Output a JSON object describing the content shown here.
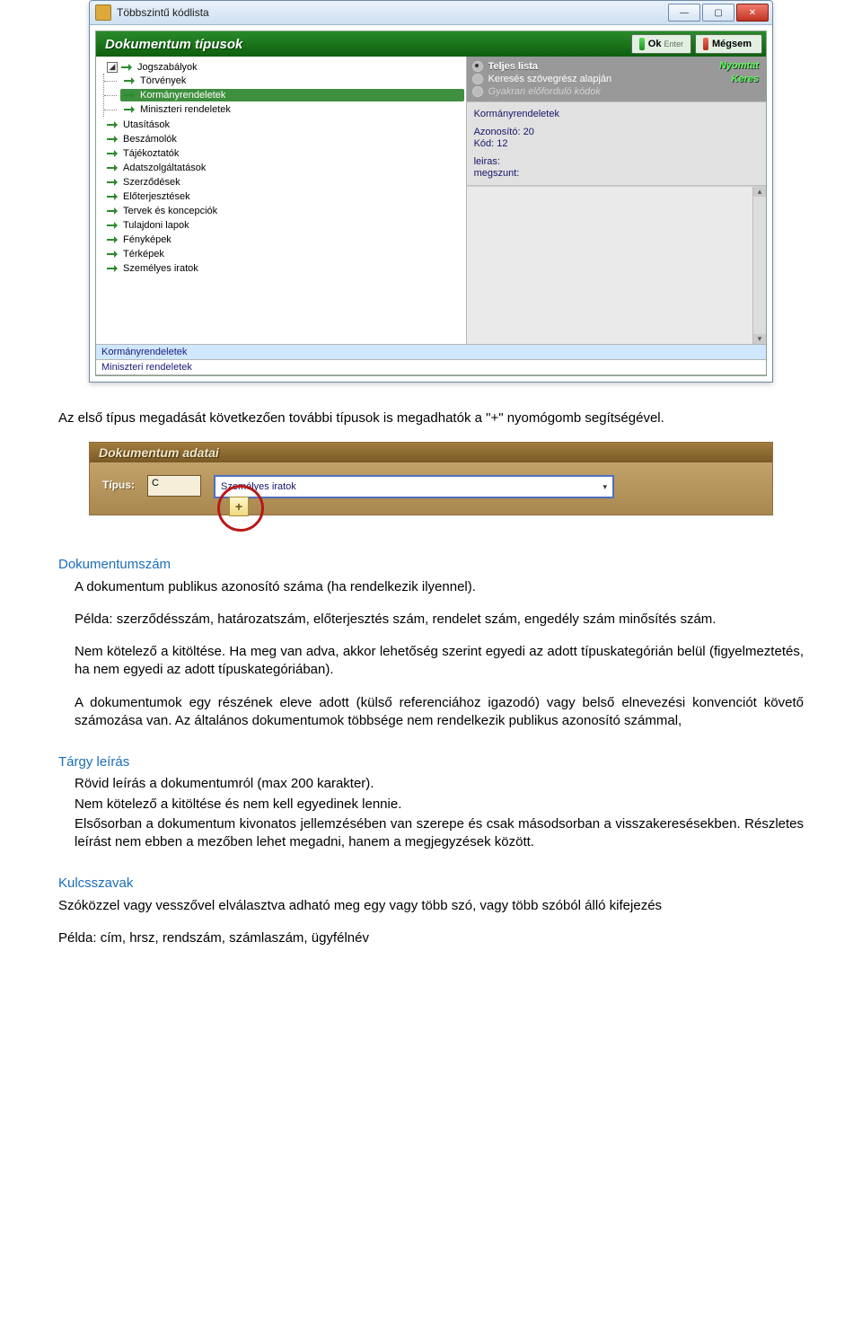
{
  "window": {
    "title": "Többszintű kódlista",
    "minimize": "—",
    "maximize": "▢",
    "close": "✕"
  },
  "ribbon": {
    "title": "Dokumentum típusok",
    "ok_bold": "Ok",
    "ok_sub": "Enter",
    "cancel_bold": "Mégsem"
  },
  "tree": {
    "root": "Jogszabályok",
    "children": [
      "Törvények",
      "Kormányrendeletek",
      "Miniszteri rendeletek"
    ],
    "selected_index": 1,
    "siblings": [
      "Utasítások",
      "Beszámolók",
      "Tájékoztatók",
      "Adatszolgáltatások",
      "Szerződések",
      "Előterjesztések",
      "Tervek és koncepciók",
      "Tulajdoni lapok",
      "Fényképek",
      "Térképek",
      "Személyes iratok"
    ]
  },
  "radio": {
    "opt0": "Teljes lista",
    "opt1": "Keresés szövegrész alapján",
    "opt2": "Gyakran előforduló kódok",
    "link_print": "Nyomtat",
    "link_search": "Keres"
  },
  "meta": {
    "title": "Kormányrendeletek",
    "id_label": "Azonosító: 20",
    "code_label": "Kód: 12",
    "leiras": "leiras:",
    "megszunt": "megszunt:"
  },
  "footer": {
    "row0": "Kormányrendeletek",
    "row1": "Miniszteri rendeletek"
  },
  "prose": {
    "p1": "Az első típus megadását következően további típusok is megadhatók a \"+\" nyomógomb segítségével."
  },
  "mini": {
    "title": "Dokumentum adatai",
    "label": "Típus:",
    "code": "C",
    "select_value": "Személyes iratok",
    "plus": "+"
  },
  "doc": {
    "h1": "Dokumentumszám",
    "p2": "A dokumentum publikus azonosító száma (ha rendelkezik ilyennel).",
    "p3": "Példa: szerződésszám, határozatszám, előterjesztés szám, rendelet szám, engedély szám minősítés szám.",
    "p4": "Nem kötelező a kitöltése. Ha meg van adva, akkor lehetőség szerint egyedi az adott típuskategórián belül (figyelmeztetés, ha nem egyedi az adott típuskategóriában).",
    "p5": "A dokumentumok egy részének eleve adott (külső referenciához igazodó) vagy belső elnevezési konvenciót követő számozása van. Az általános dokumentumok többsége nem rendelkezik publikus azonosító számmal,",
    "h2": "Tárgy leírás",
    "p6": "Rövid leírás a dokumentumról (max 200 karakter).",
    "p7": "Nem kötelező a kitöltése és nem kell egyedinek lennie.",
    "p8": "Elsősorban a dokumentum kivonatos jellemzésében van szerepe és csak másodsorban a visszakeresésekben. Részletes leírást nem ebben a mezőben lehet megadni, hanem a megjegyzések között.",
    "h3": "Kulcsszavak",
    "p9": "Szóközzel vagy vesszővel elválasztva adható meg egy vagy több szó, vagy több szóból álló kifejezés",
    "p10": "Példa:  cím, hrsz, rendszám, számlaszám, ügyfélnév"
  }
}
